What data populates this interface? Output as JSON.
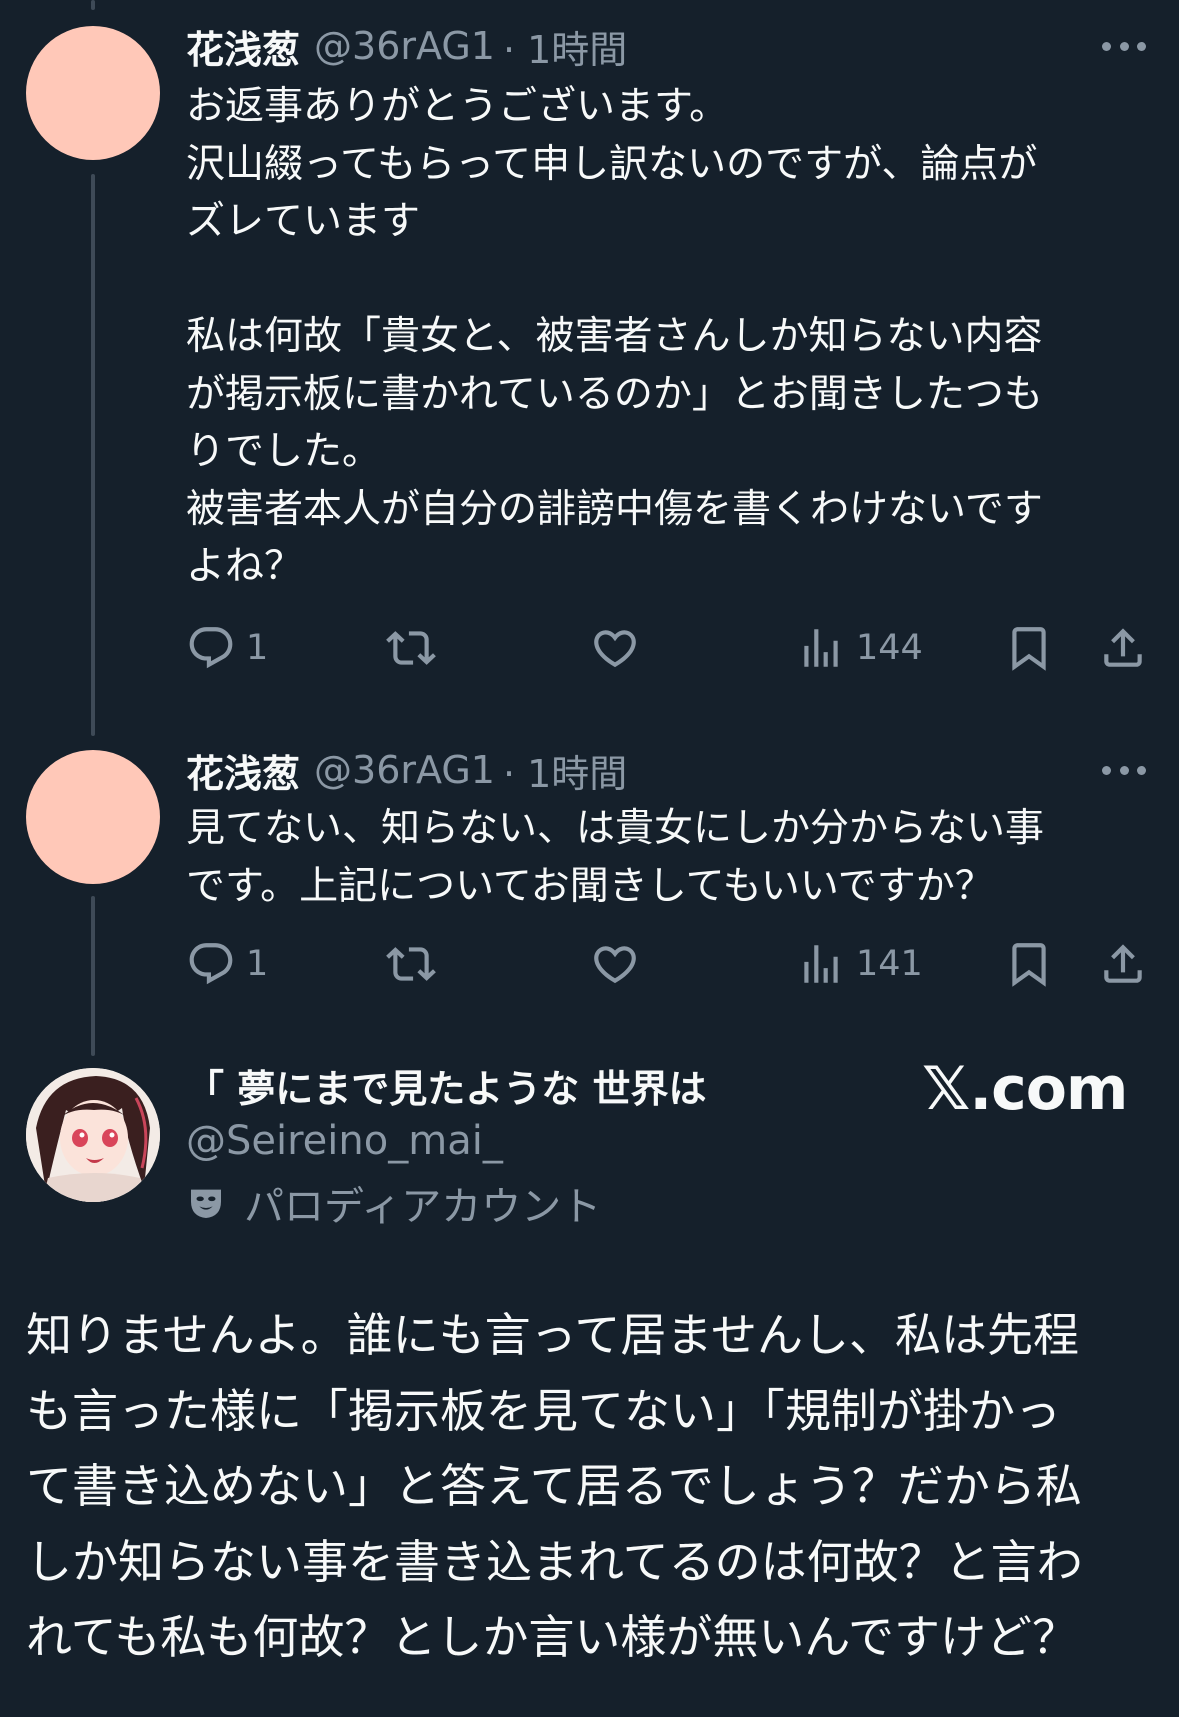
{
  "tweet1": {
    "name": "花浅葱",
    "handle": "@36rAG1",
    "time": "· 1時間",
    "body": "お返事ありがとうございます。\n沢山綴ってもらって申し訳ないのですが、論点が\nズレています\n\n私は何故「貴女と、被害者さんしか知らない内容\nが掲示板に書かれているのか」とお聞きしたつも\nりでした。\n被害者本人が自分の誹謗中傷を書くわけないです\nよね？",
    "replies": "1",
    "views": "144"
  },
  "tweet2": {
    "name": "花浅葱",
    "handle": "@36rAG1",
    "time": "· 1時間",
    "body": "見てない、知らない、は貴女にしか分からない事\nです。上記についてお聞きしてもいいですか？",
    "replies": "1",
    "views": "141"
  },
  "reply": {
    "name": "「 夢にまで見たような 世界は",
    "handle": "@Seireino_mai_",
    "parody_label": "パロディアカウント",
    "watermark": "𝕏.com",
    "body": "知りませんよ。誰にも言って居ませんし、私は先程\nも言った様に「掲示板を見てない」「規制が掛かっ\nて書き込めない」と答えて居るでしょう？だから私\nしか知らない事を書き込まれてるのは何故？と言わ\nれても私も何故？としか言い様が無いんですけど？"
  },
  "icons": [
    "reply-icon",
    "retweet-icon",
    "like-icon",
    "views-icon",
    "bookmark-icon",
    "share-icon",
    "more-icon",
    "parody-mask-icon"
  ],
  "colors": {
    "background": "#15202b",
    "text": "#f7f9f9",
    "muted": "#8b98a5",
    "avatar": "#ffc8b8",
    "thread_line": "#3e4a57"
  }
}
